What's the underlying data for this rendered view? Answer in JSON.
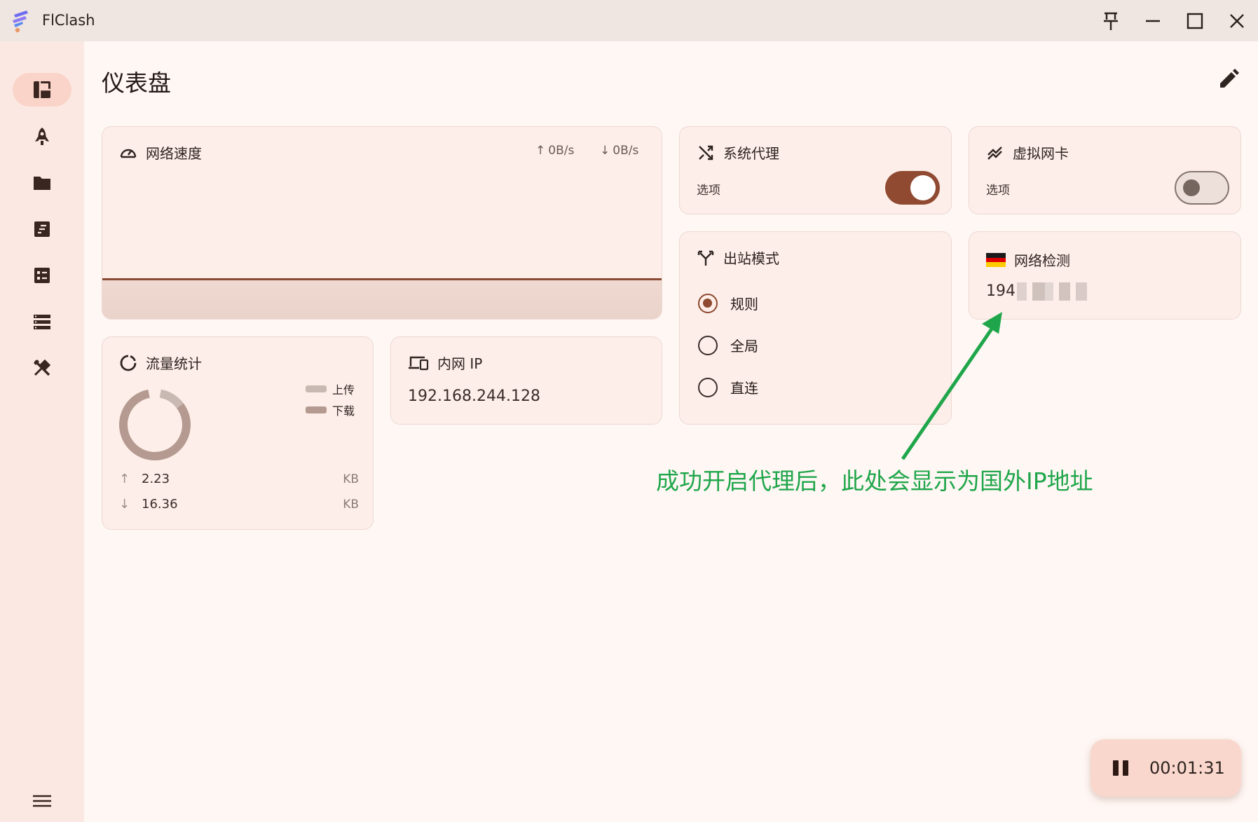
{
  "window": {
    "title": "FlClash",
    "controls": [
      "pin-icon",
      "minimize-icon",
      "maximize-icon",
      "close-icon"
    ]
  },
  "sidebar": {
    "items": [
      {
        "icon": "dashboard-icon",
        "active": true
      },
      {
        "icon": "rocket-icon",
        "active": false
      },
      {
        "icon": "folder-icon",
        "active": false
      },
      {
        "icon": "logs-icon",
        "active": false
      },
      {
        "icon": "rules-icon",
        "active": false
      },
      {
        "icon": "resources-icon",
        "active": false
      },
      {
        "icon": "tools-icon",
        "active": false
      }
    ],
    "menu_icon": "menu-icon"
  },
  "page": {
    "title": "仪表盘",
    "edit_icon": "edit-icon"
  },
  "network_speed": {
    "title": "网络速度",
    "upload": "0B/s",
    "download": "0B/s"
  },
  "system_proxy": {
    "title": "系统代理",
    "options_label": "选项",
    "enabled": true
  },
  "tun": {
    "title": "虚拟网卡",
    "options_label": "选项",
    "enabled": false
  },
  "outbound_mode": {
    "title": "出站模式",
    "options": [
      {
        "label": "规则",
        "selected": true
      },
      {
        "label": "全局",
        "selected": false
      },
      {
        "label": "直连",
        "selected": false
      }
    ]
  },
  "network_detect": {
    "title": "网络检测",
    "flag": "germany-flag-icon",
    "ip_prefix": "194"
  },
  "traffic": {
    "title": "流量统计",
    "legend_upload": "上传",
    "legend_download": "下载",
    "upload_value": "2.23",
    "upload_unit": "KB",
    "download_value": "16.36",
    "download_unit": "KB",
    "colors": {
      "upload": "#c9b9b3",
      "download": "#b49a90"
    }
  },
  "lan_ip": {
    "title": "内网 IP",
    "value": "192.168.244.128"
  },
  "annotation": {
    "text": "成功开启代理后，此处会显示为国外IP地址",
    "color": "#1fa64a"
  },
  "timer": {
    "value": "00:01:31"
  },
  "colors": {
    "accent": "#8f4a31",
    "background": "#fff7f4",
    "sidebar": "#fbe8e2",
    "card": "#fdeee9"
  }
}
